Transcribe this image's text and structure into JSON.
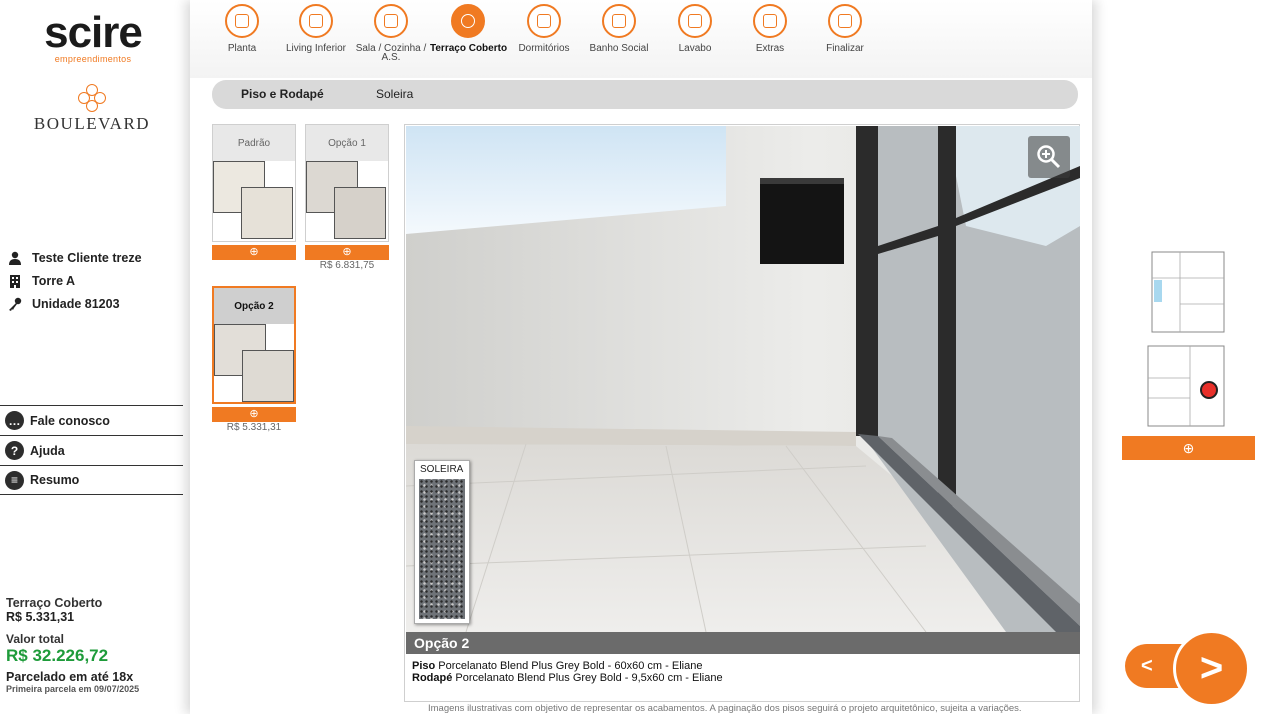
{
  "brand": {
    "logo": "scire",
    "logo_sub": "empreendimentos",
    "project_small": "SCIRE",
    "project": "BOULEVARD",
    "accent_color": "#f07a22"
  },
  "client": {
    "name": "Teste Cliente treze",
    "tower": "Torre A",
    "unit": "Unidade 81203"
  },
  "menu": [
    {
      "label": "Fale conosco",
      "icon": "chat-icon"
    },
    {
      "label": "Ajuda",
      "icon": "help-icon"
    },
    {
      "label": "Resumo",
      "icon": "document-icon"
    }
  ],
  "totals": {
    "room_label": "Terraço Coberto",
    "room_value": "R$ 5.331,31",
    "total_label": "Valor total",
    "total_value": "R$ 32.226,72",
    "installments": "Parcelado em até 18x",
    "first_installment": "Primeira parcela em 09/07/2025"
  },
  "nav": {
    "items": [
      {
        "label": "Planta",
        "icon": "floorplan-icon"
      },
      {
        "label": "Living Inferior",
        "icon": "sofa-icon"
      },
      {
        "label": "Sala / Cozinha / A.S.",
        "icon": "cutlery-icon"
      },
      {
        "label": "Terraço Coberto",
        "icon": "sun-icon"
      },
      {
        "label": "Dormitórios",
        "icon": "lamp-icon"
      },
      {
        "label": "Banho Social",
        "icon": "shower-icon"
      },
      {
        "label": "Lavabo",
        "icon": "faucet-icon"
      },
      {
        "label": "Extras",
        "icon": "tiles-icon"
      },
      {
        "label": "Finalizar",
        "icon": "checklist-icon"
      }
    ],
    "active": "Terraço Coberto"
  },
  "subtabs": [
    {
      "label": "Piso e Rodapé",
      "active": true
    },
    {
      "label": "Soleira",
      "active": false
    }
  ],
  "options": [
    {
      "label": "Padrão",
      "price": "",
      "selected": false
    },
    {
      "label": "Opção 1",
      "price": "R$ 6.831,75",
      "selected": false
    },
    {
      "label": "Opção 2",
      "price": "R$ 5.331,31",
      "selected": true
    }
  ],
  "viewer": {
    "soleira_label": "SOLEIRA",
    "selected_option": "Opção 2",
    "piso_label": "Piso",
    "piso_desc": "Porcelanato Blend Plus Grey Bold - 60x60 cm - Eliane",
    "rodape_label": "Rodapé",
    "rodape_desc": "Porcelanato Blend Plus Grey Bold - 9,5x60 cm - Eliane",
    "disclaimer": "Imagens ilustrativas com objetivo de representar os acabamentos. A paginação dos pisos seguirá o projeto arquitetônico, sujeita a variações."
  },
  "navigation": {
    "prev": "<",
    "next": ">"
  }
}
